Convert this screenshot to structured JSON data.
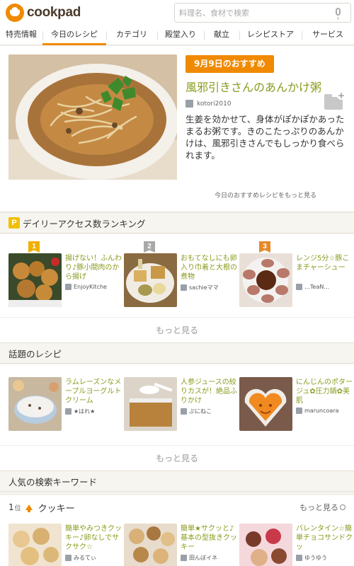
{
  "header": {
    "logo_text": "cookpad",
    "search_placeholder": "料理名、食材で検索"
  },
  "nav": {
    "items": [
      {
        "label": "特売情報",
        "active": false
      },
      {
        "label": "今日のレシピ",
        "active": true
      },
      {
        "label": "カテゴリ",
        "active": false
      },
      {
        "label": "殿堂入り",
        "active": false
      },
      {
        "label": "献立",
        "active": false
      },
      {
        "label": "レシピストア",
        "active": false
      },
      {
        "label": "サービス",
        "active": false
      }
    ]
  },
  "feature": {
    "badge": "9月9日のおすすめ",
    "title": "風邪引きさんのあんかけ粥",
    "author": "kotori2010",
    "description": "生姜を効かせて、身体がぽかぽかあったまるお粥です。きのこたっぷりのあんかけは、風邪引きさんでもしっかり食べられます。",
    "more_link": "今日のおすすめレシピをもっと見る"
  },
  "ranking": {
    "heading": "デイリーアクセス数ランキング",
    "items": [
      {
        "rank": "1",
        "title": "揚げない！ふんわり♪豚小間肉のから揚げ",
        "author": "EnjoyKitche"
      },
      {
        "rank": "2",
        "title": "おもてなしにも卵入り巾着と大根の煮物",
        "author": "sachieママ"
      },
      {
        "rank": "3",
        "title": "レンジ5分☆豚こまチャーシュー",
        "author": "…TeaN…"
      }
    ],
    "more": "もっと見る"
  },
  "topic": {
    "heading": "話題のレシピ",
    "items": [
      {
        "title": "ラムレーズンなメープルヨーグルトクリーム",
        "author": "★はれ★"
      },
      {
        "title": "人参ジュースの絞りカスが！絶品ふりかけ",
        "author": "ぷにねこ"
      },
      {
        "title": "にんじんのポタージュ✿圧力鍋✿美肌",
        "author": "maruncoara"
      }
    ],
    "more": "もっと見る"
  },
  "keywords": {
    "heading": "人気の検索キーワード",
    "rank": "1",
    "rank_suffix": "位",
    "word": "クッキー",
    "more": "もっと見る",
    "items": [
      {
        "title": "簡単やみつきクッキー♪卵なしでサクサク☆",
        "author": "みるてぃ"
      },
      {
        "title": "簡単★サクッと♪基本の型抜きクッキー",
        "author": "田んぼイネ"
      },
      {
        "title": "バレンタイン☆簡単チョコサンドクッ",
        "author": "ゆうゆう"
      }
    ]
  },
  "colors": {
    "accent": "#f08a00",
    "title_green": "#8a9a1c",
    "rank_gold": "#f0b000",
    "rank_silver": "#a8a8a8",
    "rank_bronze": "#e58a2a"
  }
}
